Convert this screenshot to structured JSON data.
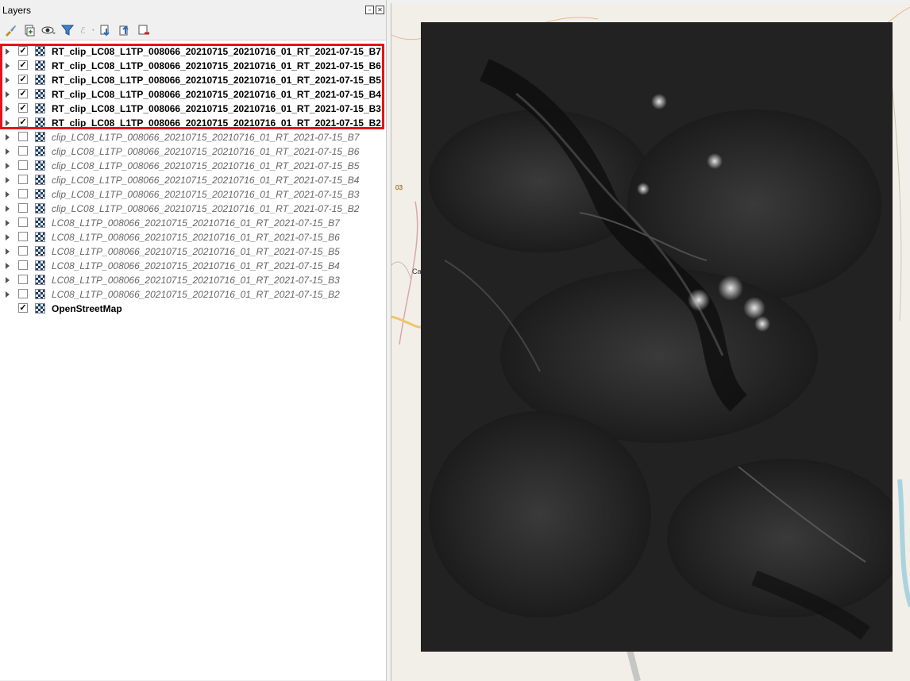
{
  "panel": {
    "title": "Layers",
    "float_icon": "float-icon",
    "close_icon": "close-icon"
  },
  "toolbar": [
    {
      "name": "style-manager-button",
      "icon": "paintbrush-icon"
    },
    {
      "name": "add-group-button",
      "icon": "add-group-icon"
    },
    {
      "name": "visibility-button",
      "icon": "eye-icon"
    },
    {
      "name": "filter-legend-button",
      "icon": "filter-icon"
    },
    {
      "name": "filter-expression-button",
      "icon": "expression-filter-icon"
    },
    {
      "name": "expand-all-button",
      "icon": "expand-all-icon"
    },
    {
      "name": "collapse-all-button",
      "icon": "collapse-all-icon"
    },
    {
      "name": "remove-layer-button",
      "icon": "remove-layer-icon"
    }
  ],
  "layers": [
    {
      "label": "RT_clip_LC08_L1TP_008066_20210715_20210716_01_RT_2021-07-15_B7",
      "checked": true,
      "style": "on"
    },
    {
      "label": "RT_clip_LC08_L1TP_008066_20210715_20210716_01_RT_2021-07-15_B6",
      "checked": true,
      "style": "on"
    },
    {
      "label": "RT_clip_LC08_L1TP_008066_20210715_20210716_01_RT_2021-07-15_B5",
      "checked": true,
      "style": "on"
    },
    {
      "label": "RT_clip_LC08_L1TP_008066_20210715_20210716_01_RT_2021-07-15_B4",
      "checked": true,
      "style": "on"
    },
    {
      "label": "RT_clip_LC08_L1TP_008066_20210715_20210716_01_RT_2021-07-15_B3",
      "checked": true,
      "style": "on"
    },
    {
      "label": "RT_clip_LC08_L1TP_008066_20210715_20210716_01_RT_2021-07-15_B2",
      "checked": true,
      "style": "on",
      "selected": true
    },
    {
      "label": "clip_LC08_L1TP_008066_20210715_20210716_01_RT_2021-07-15_B7",
      "checked": false,
      "style": "off"
    },
    {
      "label": "clip_LC08_L1TP_008066_20210715_20210716_01_RT_2021-07-15_B6",
      "checked": false,
      "style": "off"
    },
    {
      "label": "clip_LC08_L1TP_008066_20210715_20210716_01_RT_2021-07-15_B5",
      "checked": false,
      "style": "off"
    },
    {
      "label": "clip_LC08_L1TP_008066_20210715_20210716_01_RT_2021-07-15_B4",
      "checked": false,
      "style": "off"
    },
    {
      "label": "clip_LC08_L1TP_008066_20210715_20210716_01_RT_2021-07-15_B3",
      "checked": false,
      "style": "off"
    },
    {
      "label": "clip_LC08_L1TP_008066_20210715_20210716_01_RT_2021-07-15_B2",
      "checked": false,
      "style": "off"
    },
    {
      "label": "LC08_L1TP_008066_20210715_20210716_01_RT_2021-07-15_B7",
      "checked": false,
      "style": "off"
    },
    {
      "label": "LC08_L1TP_008066_20210715_20210716_01_RT_2021-07-15_B6",
      "checked": false,
      "style": "off"
    },
    {
      "label": "LC08_L1TP_008066_20210715_20210716_01_RT_2021-07-15_B5",
      "checked": false,
      "style": "off"
    },
    {
      "label": "LC08_L1TP_008066_20210715_20210716_01_RT_2021-07-15_B4",
      "checked": false,
      "style": "off"
    },
    {
      "label": "LC08_L1TP_008066_20210715_20210716_01_RT_2021-07-15_B3",
      "checked": false,
      "style": "off"
    },
    {
      "label": "LC08_L1TP_008066_20210715_20210716_01_RT_2021-07-15_B2",
      "checked": false,
      "style": "off"
    },
    {
      "label": "OpenStreetMap",
      "checked": true,
      "style": "osm"
    }
  ],
  "map": {
    "labels": [
      "03",
      "Ca"
    ],
    "colors": {
      "basemap": "#f2efe9",
      "raster": "#1c1c1c",
      "highlight": "#e3141b"
    }
  }
}
